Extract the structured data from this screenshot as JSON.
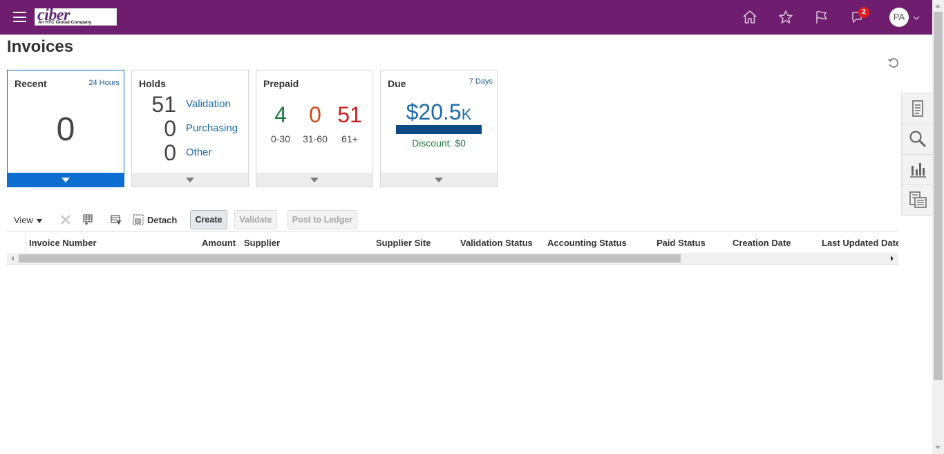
{
  "header": {
    "logo_text": "ciber",
    "logo_tagline": "An HTC Global Company",
    "notifications_count": "2",
    "user_initials": "PA",
    "colors": {
      "bar": "#6e1d6f",
      "badge": "#e41b1b"
    }
  },
  "page": {
    "title": "Invoices"
  },
  "cards": {
    "recent": {
      "title": "Recent",
      "meta": "24 Hours",
      "value": "0"
    },
    "holds": {
      "title": "Holds",
      "rows": [
        {
          "count": "51",
          "label": "Validation"
        },
        {
          "count": "0",
          "label": "Purchasing"
        },
        {
          "count": "0",
          "label": "Other"
        }
      ]
    },
    "prepaid": {
      "title": "Prepaid",
      "buckets": [
        {
          "count": "4",
          "label": "0-30",
          "color": "#1e7a3f"
        },
        {
          "count": "0",
          "label": "31-60",
          "color": "#d04a16"
        },
        {
          "count": "51",
          "label": "61+",
          "color": "#c8201f"
        }
      ]
    },
    "due": {
      "title": "Due",
      "meta": "7 Days",
      "amount": "$20.5",
      "amount_suffix": "K",
      "discount": "Discount: $0"
    }
  },
  "toolbar": {
    "view_label": "View",
    "detach_label": "Detach",
    "create_label": "Create",
    "validate_label": "Validate",
    "post_label": "Post to Ledger"
  },
  "table": {
    "columns": [
      "Invoice Number",
      "Amount",
      "Supplier",
      "Supplier Site",
      "Validation Status",
      "Accounting Status",
      "Paid Status",
      "Creation Date",
      "Last Updated Date"
    ]
  }
}
